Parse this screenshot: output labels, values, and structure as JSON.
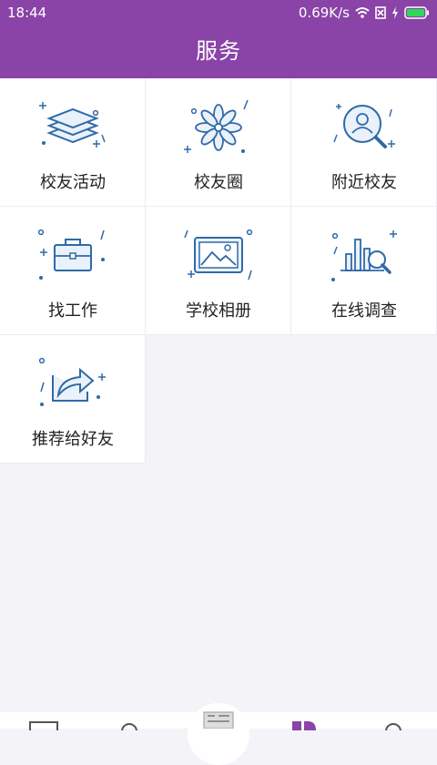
{
  "status": {
    "time": "18:44",
    "speed": "0.69K/s"
  },
  "header": {
    "title": "服务"
  },
  "services": [
    {
      "label": "校友活动",
      "icon": "layers-icon"
    },
    {
      "label": "校友圈",
      "icon": "flower-icon"
    },
    {
      "label": "附近校友",
      "icon": "search-person-icon"
    },
    {
      "label": "找工作",
      "icon": "briefcase-icon"
    },
    {
      "label": "学校相册",
      "icon": "photo-icon"
    },
    {
      "label": "在线调查",
      "icon": "chart-search-icon"
    },
    {
      "label": "推荐给好友",
      "icon": "share-icon"
    }
  ],
  "colors": {
    "brand": "#8a43a6",
    "icon": "#2f6aa8"
  }
}
